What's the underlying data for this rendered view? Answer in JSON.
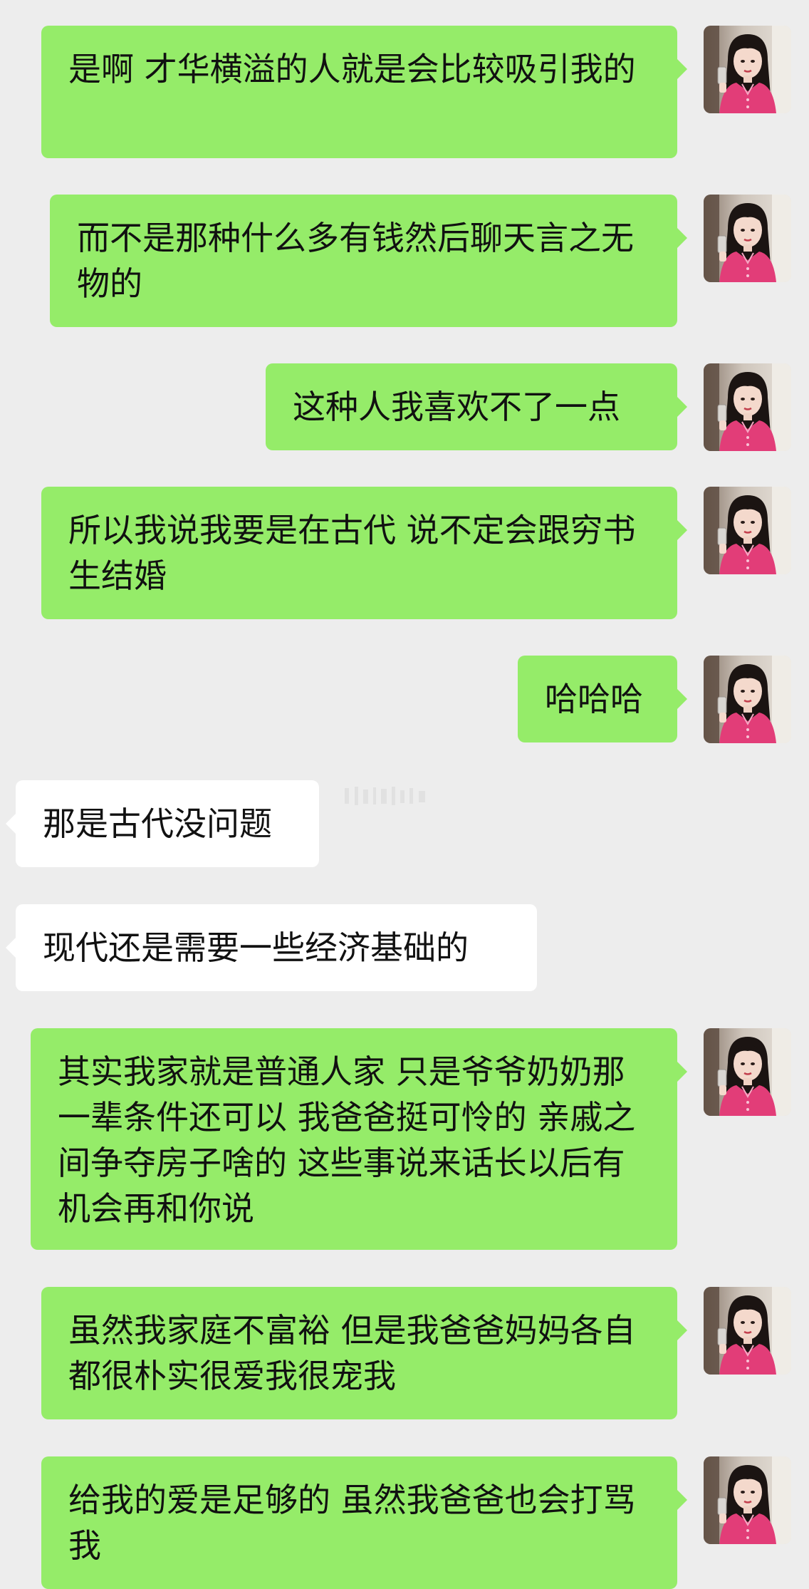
{
  "messages": [
    {
      "side": "sent",
      "text": "是啊 才华横溢的人就是会比较吸引我的"
    },
    {
      "side": "sent",
      "text": "而不是那种什么多有钱然后聊天言之无物的"
    },
    {
      "side": "sent",
      "text": "这种人我喜欢不了一点"
    },
    {
      "side": "sent",
      "text": "所以我说我要是在古代 说不定会跟穷书生结婚"
    },
    {
      "side": "sent",
      "text": "哈哈哈"
    },
    {
      "side": "recv",
      "text": "那是古代没问题"
    },
    {
      "side": "recv",
      "text": "现代还是需要一些经济基础的"
    },
    {
      "side": "sent",
      "text": "其实我家就是普通人家 只是爷爷奶奶那一辈条件还可以 我爸爸挺可怜的 亲戚之间争夺房子啥的 这些事说来话长以后有机会再和你说"
    },
    {
      "side": "sent",
      "text": "虽然我家庭不富裕 但是我爸爸妈妈各自都很朴实很爱我很宠我"
    },
    {
      "side": "sent",
      "text": "给我的爱是足够的 虽然我爸爸也会打骂我"
    }
  ],
  "colors": {
    "background": "#ededed",
    "sent_bubble": "#95ec69",
    "received_bubble": "#ffffff",
    "text": "#111111"
  },
  "icons": {
    "avatar": "user-avatar-photo"
  }
}
